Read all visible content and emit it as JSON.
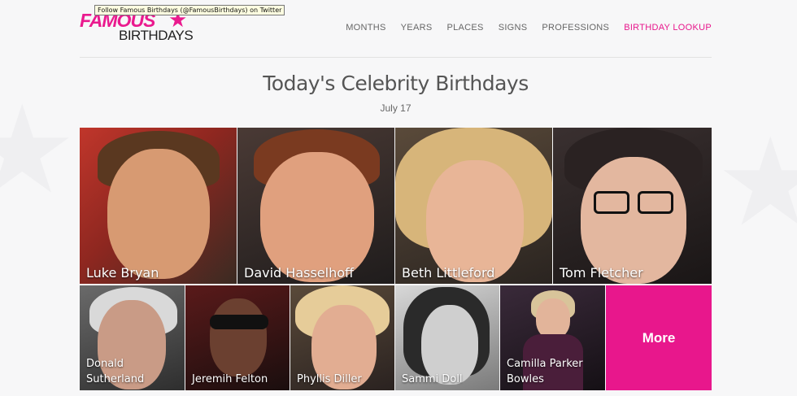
{
  "tooltip": "Follow Famous Birthdays (@FamousBirthdays) on Twitter",
  "logo": {
    "line1": "FAMOUS",
    "line2": "BIRTHDAYS"
  },
  "nav": [
    "MONTHS",
    "YEARS",
    "PLACES",
    "SIGNS",
    "PROFESSIONS",
    "BIRTHDAY LOOKUP"
  ],
  "heading": "Today's Celebrity Birthdays",
  "date": "July 17",
  "celebrities_top": [
    "Luke Bryan",
    "David Hasselhoff",
    "Beth Littleford",
    "Tom Fletcher"
  ],
  "celebrities_bottom": [
    "Donald Sutherland",
    "Jeremih Felton",
    "Phyllis Diller",
    "Sammi Doll",
    "Camilla Parker Bowles"
  ],
  "more_label": "More",
  "colors": {
    "accent": "#e8178c",
    "background": "#f7f7f8"
  }
}
